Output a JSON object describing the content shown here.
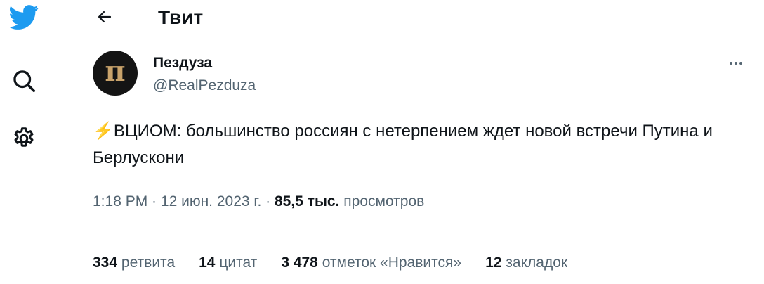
{
  "sidebar": {
    "icons": [
      "twitter-bird-icon",
      "search-icon",
      "gear-icon"
    ],
    "brand_color": "#1d9bf0"
  },
  "header": {
    "title": "Твит"
  },
  "tweet": {
    "author_name": "Пездуза",
    "author_handle": "@RealPezduza",
    "avatar_letter": "п",
    "text_emoji": "⚡",
    "text": "ВЦИОМ: большинство россиян с нетерпением ждет новой встречи Путина и Берлускони",
    "time": "1:18 PM",
    "separator": " · ",
    "date": "12 июн. 2023 г.",
    "views_count": "85,5 тыс.",
    "views_label": "просмотров"
  },
  "stats": [
    {
      "count": "334",
      "label": "ретвита"
    },
    {
      "count": "14",
      "label": "цитат"
    },
    {
      "count": "3 478",
      "label": "отметок «Нравится»"
    },
    {
      "count": "12",
      "label": "закладок"
    }
  ]
}
